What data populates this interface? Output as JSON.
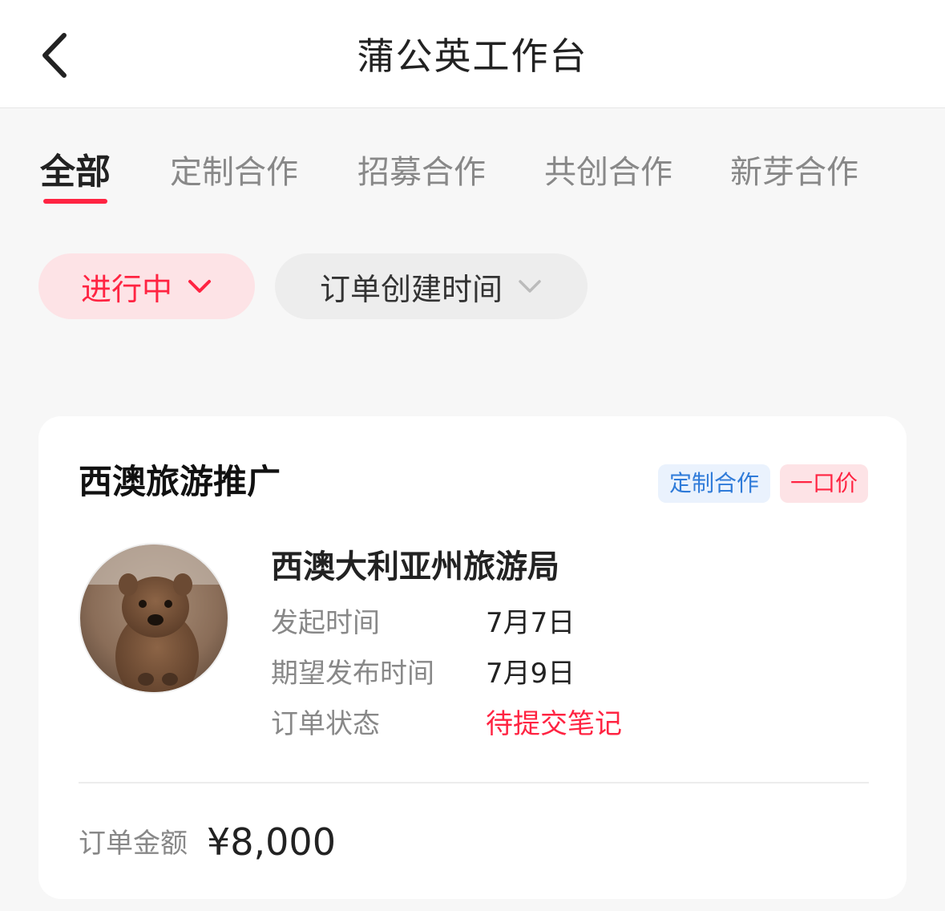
{
  "header": {
    "title": "蒲公英工作台",
    "back_icon": "chevron-left-icon"
  },
  "tabs": [
    {
      "label": "全部",
      "active": true
    },
    {
      "label": "定制合作",
      "active": false
    },
    {
      "label": "招募合作",
      "active": false
    },
    {
      "label": "共创合作",
      "active": false
    },
    {
      "label": "新芽合作",
      "active": false
    }
  ],
  "filters": {
    "status": {
      "label": "进行中",
      "icon": "chevron-down-icon"
    },
    "sort": {
      "label": "订单创建时间",
      "icon": "chevron-down-icon"
    }
  },
  "order": {
    "title": "西澳旅游推广",
    "tags": {
      "type": "定制合作",
      "price": "一口价"
    },
    "advertiser": "西澳大利亚州旅游局",
    "rows": [
      {
        "label": "发起时间",
        "value": "7月7日"
      },
      {
        "label": "期望发布时间",
        "value": "7月9日"
      },
      {
        "label": "订单状态",
        "value": "待提交笔记"
      }
    ],
    "amount_label": "订单金额",
    "amount_value": "¥8,000"
  },
  "colors": {
    "accent": "#ff2442",
    "tag_blue": "#2f7bd9",
    "background": "#f7f7f7"
  }
}
